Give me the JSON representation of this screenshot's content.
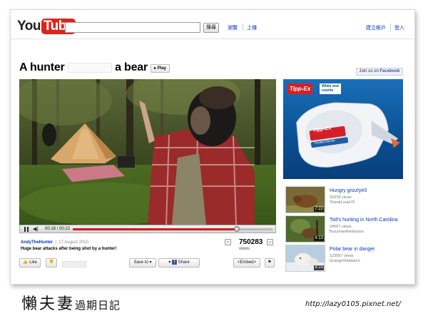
{
  "header": {
    "logo_you": "You",
    "logo_tube": "Tube",
    "search": {
      "value": "",
      "button": "搜尋"
    },
    "nav": {
      "browse": "瀏覽",
      "upload": "上傳",
      "create_account": "建立帳戶",
      "login": "登入"
    }
  },
  "video": {
    "title_prefix": "A hunter",
    "title_suffix": "a bear",
    "play_label": "Play",
    "facebook_prefix": "Join us on",
    "facebook_brand": "Facebook",
    "player": {
      "current_time": "00:18",
      "total_time": "00:22",
      "progress": 0.82
    },
    "uploader": "AndyTheHunter",
    "date": "17 August 2010",
    "description": "Huge bear attacks after being shot by a hunter!",
    "view_count": "750283",
    "views_label": "views",
    "actions": {
      "like": "Like",
      "save": "Save to",
      "share": "Share",
      "embed": "<Embed>"
    }
  },
  "ad": {
    "brand": "Tipp-Ex",
    "tag_line1": "White and",
    "tag_line2": "rewrite",
    "product_brand": "Tipp-Ex",
    "product_name": "Pocket Mouse"
  },
  "related": [
    {
      "title": "Hungry grizzly#3",
      "views": "32678 views",
      "author": "Titan&Louie75",
      "duration": "7:22"
    },
    {
      "title": "Tod's hunting in North Carolina",
      "views": "34567 views",
      "author": "Buzzmanthebossss",
      "duration": "4:13"
    },
    {
      "title": "Polar bear in danger",
      "views": "123997 views",
      "author": "Grangerthebiatch",
      "duration": "8:15"
    }
  ],
  "caption": {
    "signature_big": "懶夫妻",
    "signature_small": "過期日記",
    "url": "http://lazy0105.pixnet.net/"
  },
  "colors": {
    "youtube_red": "#d9261c",
    "link_blue": "#0033cc",
    "progress_red": "#d01b1b",
    "ad_blue": "#0a4f94"
  },
  "icons": [
    "pause-icon",
    "volume-icon",
    "thumbs-up-icon",
    "thumbs-down-icon",
    "facebook-icon",
    "flag-icon",
    "chevron-down-icon"
  ]
}
